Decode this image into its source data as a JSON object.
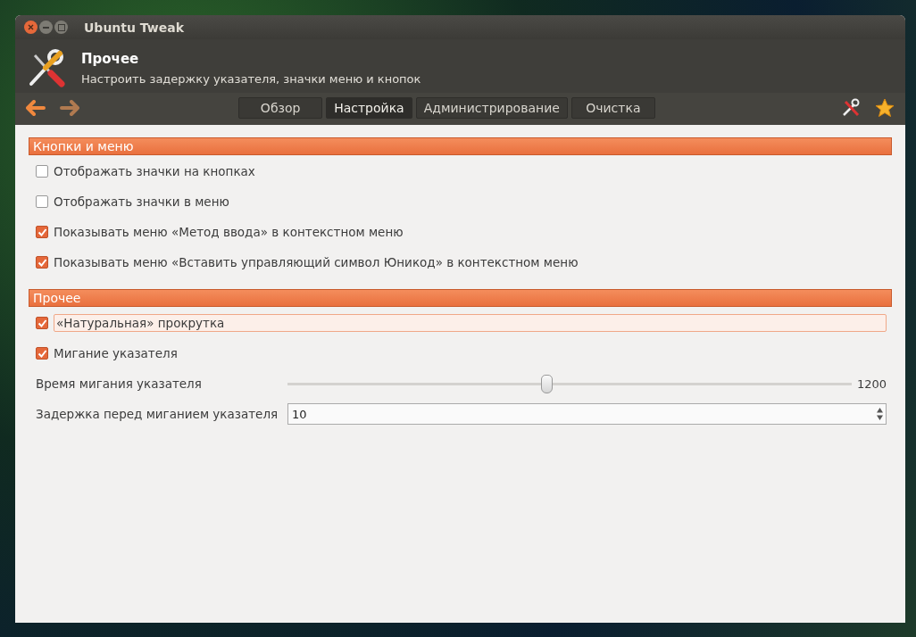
{
  "window": {
    "title": "Ubuntu Tweak"
  },
  "header": {
    "title": "Прочее",
    "subtitle": "Настроить задержку указателя, значки меню и кнопок"
  },
  "tabs": [
    {
      "label": "Обзор",
      "selected": false
    },
    {
      "label": "Настройка",
      "selected": true
    },
    {
      "label": "Администрирование",
      "selected": false
    },
    {
      "label": "Очистка",
      "selected": false
    }
  ],
  "sections": [
    {
      "title": "Кнопки и меню",
      "items": [
        {
          "kind": "checkbox",
          "label": "Отображать значки на кнопках",
          "checked": false,
          "focused": false
        },
        {
          "kind": "checkbox",
          "label": "Отображать значки в меню",
          "checked": false,
          "focused": false
        },
        {
          "kind": "checkbox",
          "label": "Показывать меню «Метод ввода» в контекстном меню",
          "checked": true,
          "focused": false
        },
        {
          "kind": "checkbox",
          "label": "Показывать меню «Вставить управляющий символ Юникод» в контекстном меню",
          "checked": true,
          "focused": false
        }
      ]
    },
    {
      "title": "Прочее",
      "items": [
        {
          "kind": "checkbox",
          "label": "«Натуральная» прокрутка",
          "checked": true,
          "focused": true
        },
        {
          "kind": "checkbox",
          "label": "Мигание указателя",
          "checked": true,
          "focused": false
        },
        {
          "kind": "slider",
          "label": "Время мигания указателя",
          "level": 0.457,
          "reading": "1200"
        },
        {
          "kind": "spin",
          "label": "Задержка перед миганием указателя",
          "value": "10"
        }
      ]
    }
  ]
}
